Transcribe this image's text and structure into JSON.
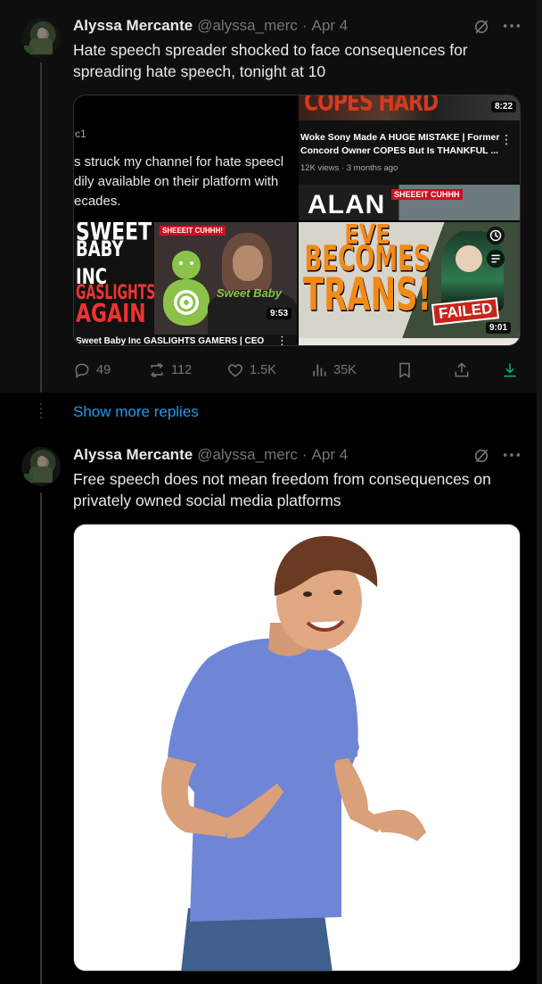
{
  "tweet1": {
    "author_name": "Alyssa Mercante",
    "handle": "@alyssa_merc",
    "separator": "·",
    "date": "Apr 4",
    "text": "Hate speech spreader shocked to face consequences for spreading hate speech, tonight at 10",
    "media": {
      "top_left": {
        "line0": "c1",
        "line1": "s struck my channel for hate speecl",
        "line2": "dily available on their platform with",
        "line3": "ecades."
      },
      "top_right": {
        "thumb_text": "COPES HARD",
        "duration": "8:22",
        "title_line1": "Woke Sony Made A HUGE MISTAKE | Former",
        "title_line2": "Concord Owner COPES But Is THANKFUL ...",
        "meta": "12K views · 3 months ago",
        "next_thumb_text": "ALAN",
        "next_thumb_badge": "SHEEEIT CUHHH"
      },
      "bottom_left": {
        "thumb_lines": [
          "SWEET",
          "BABY INC",
          "GASLIGHTS",
          "AGAIN"
        ],
        "badge": "SHEEEIT CUHHH!",
        "brand": "Sweet Baby",
        "duration": "9:53",
        "title": "Sweet Baby Inc GASLIGHTS GAMERS | CEO"
      },
      "bottom_right": {
        "thumb_lines": [
          "EVE",
          "BECOMES",
          "TRANS!"
        ],
        "failed_label": "FAILED",
        "duration": "9:01"
      }
    },
    "actions": {
      "replies": "49",
      "reposts": "112",
      "likes": "1.5K",
      "views": "35K"
    }
  },
  "show_more_replies": "Show more replies",
  "tweet2": {
    "author_name": "Alyssa Mercante",
    "handle": "@alyssa_merc",
    "separator": "·",
    "date": "Apr 4",
    "text": "Free speech does not mean freedom from consequences on privately owned social media platforms"
  },
  "colors": {
    "background": "#000000",
    "text": "#e7e9ea",
    "muted": "#71767b",
    "link": "#1d9bf0",
    "border": "#2f3336"
  },
  "icons": {
    "grok": "grok-icon",
    "more": "more-icon",
    "reply": "reply-icon",
    "repost": "repost-icon",
    "like": "heart-icon",
    "views": "views-icon",
    "bookmark": "bookmark-icon",
    "share": "share-icon",
    "download": "download-icon"
  }
}
